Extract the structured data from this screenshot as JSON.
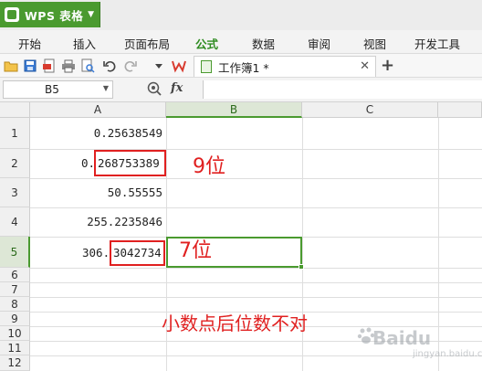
{
  "app": {
    "title": "WPS 表格"
  },
  "ribbon": {
    "tabs": [
      {
        "label": "开始",
        "active": false
      },
      {
        "label": "插入",
        "active": false
      },
      {
        "label": "页面布局",
        "active": false
      },
      {
        "label": "公式",
        "active": true
      },
      {
        "label": "数据",
        "active": false
      },
      {
        "label": "审阅",
        "active": false
      },
      {
        "label": "视图",
        "active": false
      },
      {
        "label": "开发工具",
        "active": false
      }
    ]
  },
  "toolbar": {
    "icons": [
      "open-folder-icon",
      "save-icon",
      "export-pdf-icon",
      "print-icon",
      "print-preview-icon",
      "undo-icon",
      "redo-icon",
      "dropdown-icon"
    ],
    "document_tab": {
      "label": "工作簿1 *"
    }
  },
  "formula_bar": {
    "cell_ref": "B5",
    "fx_label": "fx",
    "value": ""
  },
  "sheet": {
    "columns": [
      "A",
      "B",
      "C"
    ],
    "rows": [
      "1",
      "2",
      "3",
      "4",
      "5",
      "6",
      "7",
      "8",
      "9",
      "10",
      "11",
      "12"
    ],
    "selected_cell": "B5",
    "cells": {
      "a1": "0.25638549",
      "a2_prefix": "0.",
      "a2_digits": "268753389",
      "a3": "50.55555",
      "a4": "255.2235846",
      "a5_prefix": "306.",
      "a5_digits": "3042734"
    }
  },
  "annotations": {
    "nine_digits": "9位",
    "seven_digits": "7位",
    "note": "小数点后位数不对",
    "color": "#e02020"
  },
  "watermark": {
    "text": "Baidu",
    "sub": "jingyan.baidu.com"
  },
  "colors": {
    "accent": "#4a9a2f",
    "annotation": "#e02020"
  }
}
